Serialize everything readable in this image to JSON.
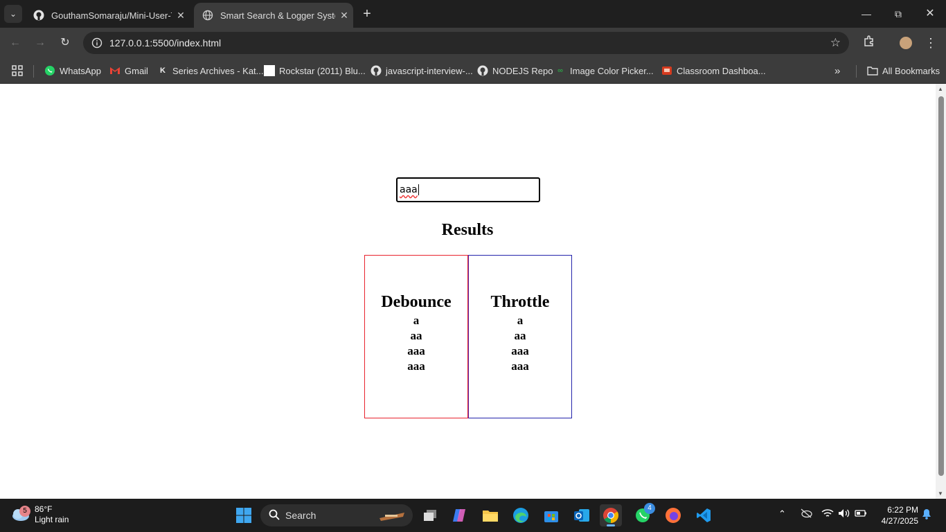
{
  "browser": {
    "tabs": [
      {
        "title": "GouthamSomaraju/Mini-User-T",
        "active": false,
        "icon": "github-icon"
      },
      {
        "title": "Smart Search & Logger System",
        "active": true,
        "icon": "globe-icon"
      }
    ],
    "url": "127.0.0.1:5500/index.html",
    "bookmarks": [
      {
        "label": "WhatsApp",
        "icon": "whatsapp-icon"
      },
      {
        "label": "Gmail",
        "icon": "gmail-icon"
      },
      {
        "label": "Series Archives - Kat...",
        "icon": "k-icon"
      },
      {
        "label": "Rockstar (2011) Blu...",
        "icon": "blank-page-icon"
      },
      {
        "label": "javascript-interview-...",
        "icon": "github-icon"
      },
      {
        "label": "NODEJS Repo",
        "icon": "github-icon"
      },
      {
        "label": "Image Color Picker...",
        "icon": "glasses-icon"
      },
      {
        "label": "Classroom Dashboa...",
        "icon": "classroom-icon"
      }
    ],
    "all_bookmarks": "All Bookmarks"
  },
  "page": {
    "search_value": "aaa",
    "results_title": "Results",
    "debounce": {
      "title": "Debounce",
      "logs": [
        "a",
        "aa",
        "aaa",
        "aaa"
      ],
      "border_color": "#e8212c"
    },
    "throttle": {
      "title": "Throttle",
      "logs": [
        "a",
        "aa",
        "aaa",
        "aaa"
      ],
      "border_color": "#2222aa"
    }
  },
  "taskbar": {
    "weather": {
      "temp": "86°F",
      "desc": "Light rain",
      "badge": "5"
    },
    "search_label": "Search",
    "whatsapp_badge": "4",
    "time": "6:22 PM",
    "date": "4/27/2025"
  }
}
